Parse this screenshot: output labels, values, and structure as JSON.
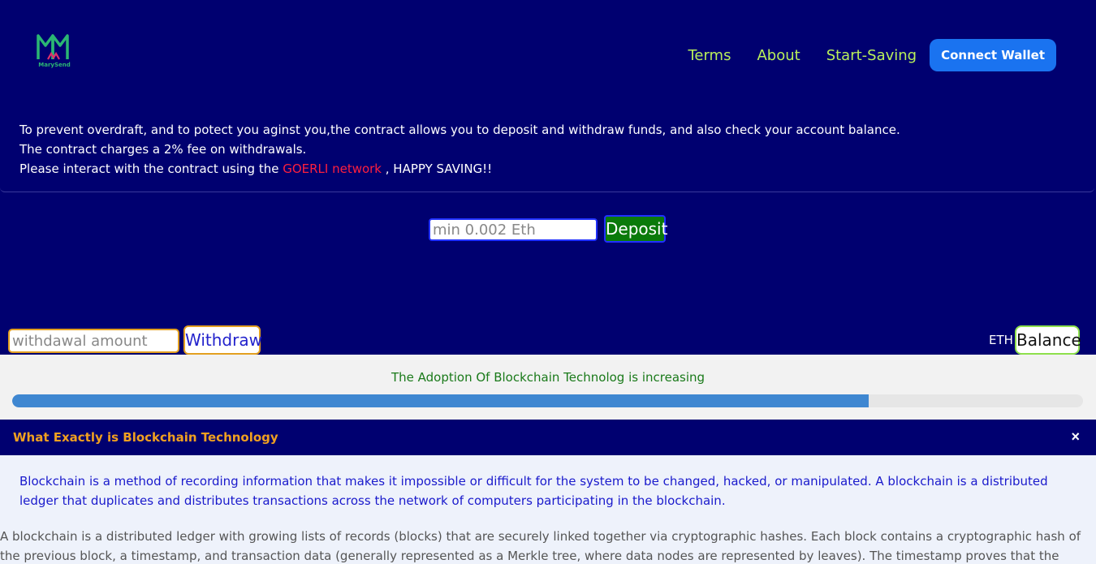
{
  "header": {
    "logo_text": "MarySend",
    "nav": [
      "Terms",
      "About",
      "Start-Saving"
    ],
    "connect_label": "Connect Wallet"
  },
  "intro": {
    "line1": "To prevent overdraft, and to potect you aginst you,the contract allows you to deposit and withdraw funds, and also check your account balance.",
    "line2": "The contract charges a 2% fee on withdrawals.",
    "line3_prefix": "Please interact with the contract using the ",
    "line3_network": "GOERLI network",
    "line3_suffix": " , HAPPY SAVING!!"
  },
  "deposit": {
    "placeholder": "min 0.002 Eth",
    "button_label": "Deposit"
  },
  "withdraw": {
    "placeholder": "withdawal amount",
    "button_label": "Withdraw"
  },
  "balance": {
    "unit": "ETH",
    "button_label": "Balance"
  },
  "progress": {
    "text": "The Adoption Of Blockchain Technolog is increasing",
    "value_percent": 80
  },
  "info": {
    "title": "What Exactly is Blockchain Technology",
    "close_symbol": "×",
    "paragraph1": "Blockchain is a method of recording information that makes it impossible or difficult for the system to be changed, hacked, or manipulated. A blockchain is a distributed ledger that duplicates and distributes transactions across the network of computers participating in the blockchain.",
    "paragraph2": "A blockchain is a distributed ledger with growing lists of records (blocks) that are securely linked together via cryptographic hashes. Each block contains a cryptographic hash of the previous block, a timestamp, and transaction data (generally represented as a Merkle tree, where data nodes are represented by leaves). The timestamp proves that the transaction data existed when"
  },
  "colors": {
    "background": "#000070",
    "nav_link": "#b9f05a",
    "connect_button": "#1a73f0",
    "network_highlight": "#ff1f3d",
    "deposit_button": "#0a7a0a",
    "progress_fill": "#3f87d1",
    "info_title": "#f0a020"
  }
}
